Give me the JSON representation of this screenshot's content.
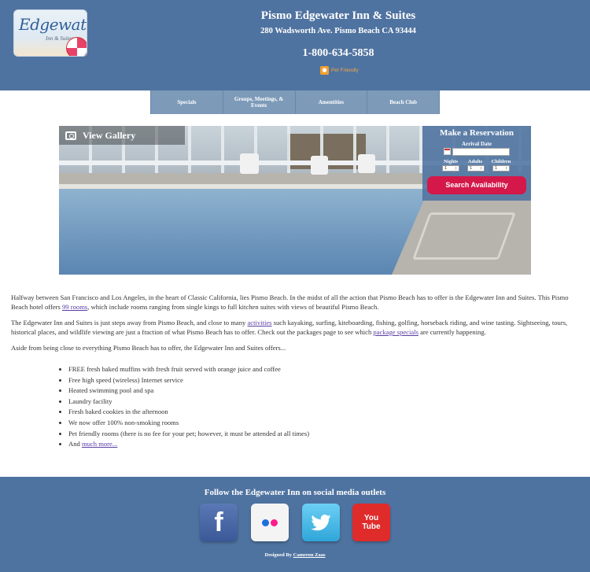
{
  "header": {
    "logo_text": "Edgewater",
    "logo_sub": "Inn & Suites",
    "hotel_name": "Pismo Edgewater Inn & Suites",
    "address": "280 Wadsworth Ave. Pismo Beach CA 93444",
    "phone": "1-800-634-5858",
    "pet_friendly": "Pet Friendly"
  },
  "nav": {
    "items": [
      "Specials",
      "Groups, Meetings, & Events",
      "Amentities",
      "Beach Club"
    ]
  },
  "hero": {
    "gallery_label": "View Gallery"
  },
  "reservation": {
    "title": "Make a Reservation",
    "arrival_label": "Arrival Date",
    "arrival_value": "",
    "nights_label": "Nights",
    "adults_label": "Adults",
    "children_label": "Children",
    "nights_value": "1",
    "adults_value": "1",
    "children_value": "1",
    "search_label": "Search Availability"
  },
  "content": {
    "p1": "Halfway between San Francisco and Los Angeles, in the heart of Classic California, lies Pismo Beach. In the midst of all the action that Pismo Beach has to offer is the Edgewater Inn and Suites. This Pismo Beach hotel offers ",
    "p1_link": "99 rooms",
    "p1_end": ", which include rooms ranging from single kings to full kitchen suites with views of beautiful Pismo Beach.",
    "p2": "The Edgewater Inn and Suites is just steps away from Pismo Beach, and close to many ",
    "p2_link1": "activities",
    "p2_mid": " such kayaking, surfing, kiteboarding, fishing, golfing, horseback riding, and wine tasting. Sightseeing, tours, historical places, and wildlife viewing are just a fraction of what Pismo Beach has to offer. Check out the packages page to see which ",
    "p2_link2": "package specials",
    "p2_end": " are currently happening.",
    "p3": "Aside from being close to everything Pismo Beach has to offer, the Edgewater Inn and Suites offers...",
    "features": [
      "FREE fresh baked muffins with fresh fruit served with orange juice and coffee",
      "Free high speed (wireless) Internet service",
      "Heated swimming pool and spa",
      "Laundry facility",
      "Fresh baked cookies in the afternoon",
      "We now offer 100% non-smoking rooms",
      "Pet friendly rooms (there is no fee for your pet; however, it must be attended at all times)"
    ],
    "last_feature_prefix": "And ",
    "last_feature_link": "much more..."
  },
  "footer": {
    "follow_text": "Follow the Edgewater Inn on social media outlets",
    "facebook_glyph": "f",
    "youtube_text_1": "You",
    "youtube_text_2": "Tube",
    "designed_prefix": "Designed By ",
    "designer": "Cameron Zaas"
  },
  "colors": {
    "header_bg": "#4f73a0",
    "nav_bg": "#7d9ab9",
    "search_button": "#d4184a",
    "link": "#5b3ea6"
  }
}
